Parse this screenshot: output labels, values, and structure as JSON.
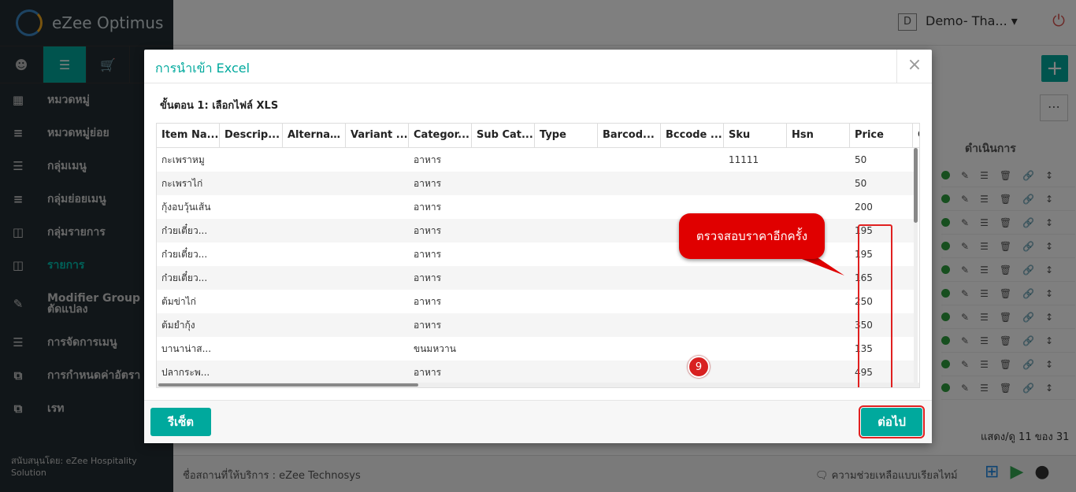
{
  "app": {
    "brand": "eZee Optimus",
    "property": "Demo- Tha...",
    "property_badge": "D"
  },
  "sidebar": {
    "items": [
      {
        "label": "หมวดหมู่",
        "icon": "table-icon"
      },
      {
        "label": "หมวดหมู่ย่อย",
        "icon": "list-icon"
      },
      {
        "label": "กลุ่มเมนู",
        "icon": "list-icon"
      },
      {
        "label": "กลุ่มย่อยเมนู",
        "icon": "list-icon"
      },
      {
        "label": "กลุ่มรายการ",
        "icon": "box-icon"
      },
      {
        "label": "รายการ",
        "icon": "box-icon"
      },
      {
        "label": "Modifier Group / กลุ่ม",
        "label2": "ตัดแปลง",
        "icon": "edit-icon"
      },
      {
        "label": "การจัดการเมนู",
        "icon": "menu-icon"
      },
      {
        "label": "การกำหนดค่าอัตรา",
        "icon": "copy-icon"
      },
      {
        "label": "เรท",
        "icon": "copy-icon"
      }
    ],
    "footer": "สนับสนุนโดย: eZee Hospitality Solution"
  },
  "right_panel": {
    "action_header": "ดำเนินการ",
    "paging": "แสดง/ดู 11 ของ 31"
  },
  "bottom": {
    "company": "ชื่อสถานที่ให้บริการ : eZee Technosys",
    "support": "ความช่วยเหลือแบบเรียลไทม์"
  },
  "modal": {
    "title": "การนำเข้า Excel",
    "close": "×",
    "step": "ขั้นตอน 1: เลือกไฟล์ XLS",
    "columns": [
      "Item Na...",
      "Descrip...",
      "Alternat...",
      "Variant ...",
      "Categor...",
      "Sub Cat...",
      "Type",
      "Barcod...",
      "Bccode ...",
      "Sku",
      "Hsn",
      "Price",
      "C"
    ],
    "rows": [
      [
        "กะเพราหมู",
        "",
        "",
        "",
        "อาหาร",
        "",
        "",
        "",
        "",
        "11111",
        "",
        "50"
      ],
      [
        "กะเพราไก่",
        "",
        "",
        "",
        "อาหาร",
        "",
        "",
        "",
        "",
        "",
        "",
        "50"
      ],
      [
        "กุ้งอบวุ้นเส้น",
        "",
        "",
        "",
        "อาหาร",
        "",
        "",
        "",
        "",
        "",
        "",
        "200"
      ],
      [
        "ก๋วยเตี๋ยว...",
        "",
        "",
        "",
        "อาหาร",
        "",
        "",
        "",
        "",
        "",
        "",
        "195"
      ],
      [
        "ก๋วยเตี๋ยว...",
        "",
        "",
        "",
        "อาหาร",
        "",
        "",
        "",
        "",
        "",
        "",
        "195"
      ],
      [
        "ก๋วยเตี๋ยว...",
        "",
        "",
        "",
        "อาหาร",
        "",
        "",
        "",
        "",
        "",
        "",
        "165"
      ],
      [
        "ต้มข่าไก่",
        "",
        "",
        "",
        "อาหาร",
        "",
        "",
        "",
        "",
        "",
        "",
        "250"
      ],
      [
        "ต้มยำกุ้ง",
        "",
        "",
        "",
        "อาหาร",
        "",
        "",
        "",
        "",
        "",
        "",
        "350"
      ],
      [
        "บานาน่าส...",
        "",
        "",
        "",
        "ขนมหวาน",
        "",
        "",
        "",
        "",
        "",
        "",
        "135"
      ],
      [
        "ปลากระพ...",
        "",
        "",
        "",
        "อาหาร",
        "",
        "",
        "",
        "",
        "",
        "",
        "495"
      ]
    ],
    "callout": "ตรวจสอบราคาอีกครั้ง",
    "reset_label": "รีเซ็ต",
    "next_label": "ต่อไป",
    "step_badge": "9"
  }
}
